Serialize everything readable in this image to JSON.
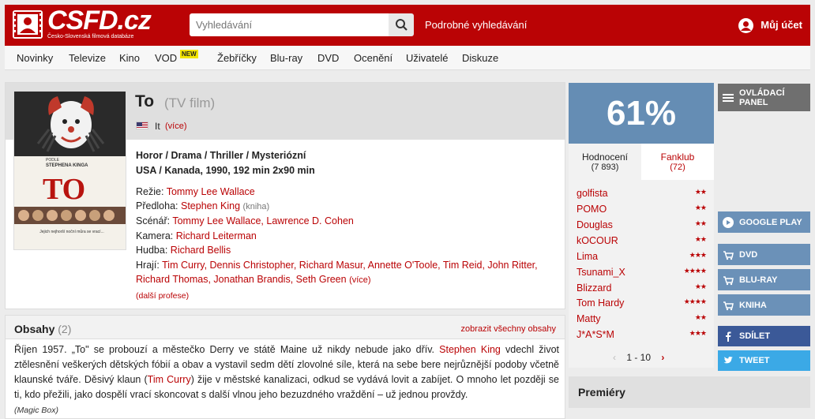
{
  "header": {
    "logo_text": "CSFD.cz",
    "logo_subtitle": "Česko-Slovenská filmová databáze",
    "search_placeholder": "Vyhledávání",
    "advanced_search": "Podrobné vyhledávání",
    "account": "Můj účet"
  },
  "nav": {
    "items": [
      "Novinky",
      "Televize",
      "Kino",
      "VOD",
      "Žebříčky",
      "Blu-ray",
      "DVD",
      "Ocenění",
      "Uživatelé",
      "Diskuze"
    ],
    "vod_badge": "NEW"
  },
  "film": {
    "title": "To",
    "subtitle": "(TV film)",
    "original_name": "It",
    "original_more": "(více)",
    "genres": "Horor / Drama / Thriller / Mysteriózní",
    "origin": "USA / Kanada, 1990, 192 min 2x90 min",
    "director_label": "Režie:",
    "director": "Tommy Lee Wallace",
    "source_label": "Předloha:",
    "source": "Stephen King",
    "source_note": "(kniha)",
    "writer_label": "Scénář:",
    "writers": "Tommy Lee Wallace, Lawrence D. Cohen",
    "camera_label": "Kamera:",
    "camera": "Richard Leiterman",
    "music_label": "Hudba:",
    "music": "Richard Bellis",
    "cast_label": "Hrají:",
    "cast_line1": "Tim Curry, Dennis Christopher, Richard Masur, Annette O'Toole, Tim Reid, John Ritter,",
    "cast_line2": "Richard Thomas, Jonathan Brandis, Seth Green",
    "cast_more": "(více)",
    "more_professions": "(další profese)",
    "poster": {
      "author_small": "PODLE",
      "author": "STEPHENA KINGA",
      "title": "TO",
      "tagline": "Jejich nejhorší noční můra se vrací..."
    }
  },
  "synopsis": {
    "title": "Obsahy",
    "count": "(2)",
    "show_all": "zobrazit všechny obsahy",
    "text_before": "Říjen 1957. „To\" se probouzí a městečko Derry ve státě Maine už nikdy nebude jako dřív. ",
    "text_link1": "Stephen King",
    "text_mid": " vdechl život ztělesnění veškerých dětských fóbií a obav a vystavil sedm dětí zlovolné síle, která na sebe bere nejrůznější podoby včetně klaunské tváře. Děsivý klaun (",
    "text_link2": "Tim Curry",
    "text_after": ") žije v městské kanalizaci, odkud se vydává lovit a zabíjet. O mnoho let později se ti, kdo přežili, jako dospělí vrací skoncovat s další vlnou jeho bezuzdného vraždění – už jednou provždy.",
    "source": "(Magic Box)"
  },
  "rating": {
    "percent": "61%",
    "tab_ratings": "Hodnocení",
    "ratings_count": "(7 893)",
    "tab_fanclub": "Fanklub",
    "fanclub_count": "(72)",
    "users": [
      {
        "name": "golfista",
        "stars": "★★"
      },
      {
        "name": "POMO",
        "stars": "★★"
      },
      {
        "name": "Douglas",
        "stars": "★★"
      },
      {
        "name": "kOCOUR",
        "stars": "★★"
      },
      {
        "name": "Lima",
        "stars": "★★★"
      },
      {
        "name": "Tsunami_X",
        "stars": "★★★★"
      },
      {
        "name": "Blizzard",
        "stars": "★★"
      },
      {
        "name": "Tom Hardy",
        "stars": "★★★★"
      },
      {
        "name": "Matty",
        "stars": "★★"
      },
      {
        "name": "J*A*S*M",
        "stars": "★★★"
      }
    ],
    "pager": "1 - 10",
    "pager_prev": "‹",
    "pager_next": "›"
  },
  "sidebar": {
    "panel": "OVLÁDACÍ PANEL",
    "google_play": "GOOGLE PLAY",
    "dvd": "DVD",
    "bluray": "BLU-RAY",
    "kniha": "KNIHA",
    "share": "SDÍLET",
    "tweet": "TWEET"
  },
  "premiery": "Premiéry",
  "colors": {
    "brand": "#ba0305",
    "rating_blue": "#658db4",
    "facebook": "#3b5998",
    "twitter": "#3ba9e6"
  }
}
